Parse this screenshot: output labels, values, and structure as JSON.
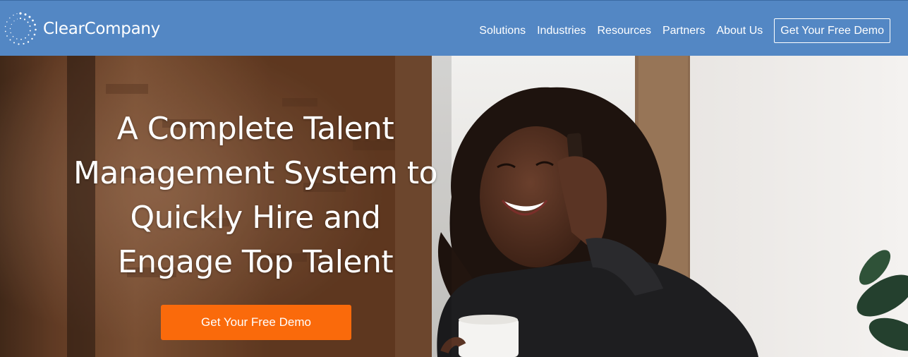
{
  "brand": {
    "name": "ClearCompany"
  },
  "nav": {
    "items": [
      {
        "label": "Solutions"
      },
      {
        "label": "Industries"
      },
      {
        "label": "Resources"
      },
      {
        "label": "Partners"
      },
      {
        "label": "About Us"
      }
    ],
    "cta_label": "Get Your Free Demo"
  },
  "hero": {
    "headline": "A Complete Talent Management System to Quickly Hire and Engage Top Talent",
    "cta_label": "Get Your Free Demo"
  },
  "colors": {
    "header_bg": "#5387c4",
    "cta_orange": "#fa6a0b",
    "text_white": "#ffffff"
  }
}
